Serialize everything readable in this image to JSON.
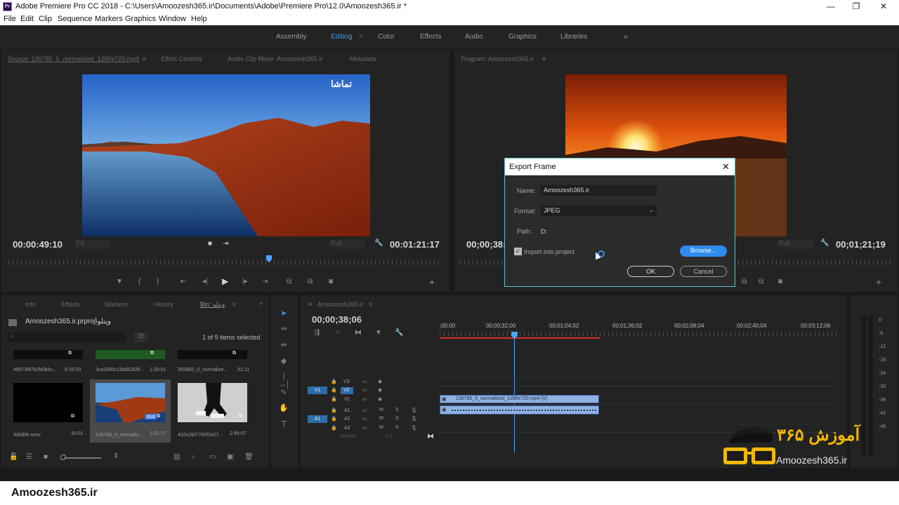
{
  "titlebar": {
    "app_icon": "Pr",
    "title": "Adobe Premiere Pro CC 2018 - C:\\Users\\Amoozesh365.ir\\Documents\\Adobe\\Premiere Pro\\12.0\\Amoozesh365.ir *",
    "minimize": "—",
    "maximize": "❐",
    "close": "✕"
  },
  "menu": [
    "File",
    "Edit",
    "Clip",
    "Sequence",
    "Markers",
    "Graphics",
    "Window",
    "Help"
  ],
  "workspaces": {
    "items": [
      "Assembly",
      "Editing",
      "Color",
      "Effects",
      "Audio",
      "Graphics",
      "Libraries"
    ],
    "active": "Editing",
    "more": "»"
  },
  "source_panel": {
    "tabs": [
      "Source: 136785_0_normalized_1280x720.mp4",
      "Effect Controls",
      "Audio Clip Mixer: Amoozesh365.ir",
      "Metadata"
    ],
    "timecode": "00:00:49:10",
    "fit": "Fit",
    "full": "Full",
    "duration": "00:01:21:17",
    "watermark": "تماشا"
  },
  "program_panel": {
    "tab": "Program: Amoozesh365.ir",
    "timecode": "00;00;38;06",
    "full": "Full",
    "duration": "00;01;21;19"
  },
  "export_dialog": {
    "title": "Export Frame",
    "name_label": "Name:",
    "name_value": "Amoozesh365.ir",
    "format_label": "Format:",
    "format_value": "JPEG",
    "path_label": "Path:",
    "path_value": "D:",
    "import_label": "Import into project",
    "import_checked": true,
    "browse": "Browse...",
    "ok": "OK",
    "cancel": "Cancel"
  },
  "project_panel": {
    "tabs": [
      "Info",
      "Effects",
      "Markers",
      "History",
      "Bin: ویتلو"
    ],
    "more": "»",
    "project_name": "Amoozesh365.ir.prproj\\ویتلو",
    "selection_info": "1 of 9 items selected",
    "items": [
      {
        "name": "48970f47b2b0b5c...",
        "duration": "6:33:00"
      },
      {
        "name": "3ce3395c15dd52b9f...",
        "duration": "1:33:01"
      },
      {
        "name": "355882_0_normalize...",
        "duration": "31:11"
      },
      {
        "name": "Wildlife.wmv",
        "duration": "30:01"
      },
      {
        "name": "136785_0_normaliz...",
        "duration": "1:21:17"
      },
      {
        "name": "432e2bf7765f0e27...",
        "duration": "2:45:07"
      }
    ]
  },
  "timeline": {
    "tab": "Amoozesh365.ir",
    "timecode": "00;00;38;06",
    "ruler_labels": [
      ";00;00",
      "00;00;32;00",
      "00;01;04;02",
      "00;01;36;02",
      "00;02;08;04",
      "00;02;40;04",
      "00;03;12;06"
    ],
    "tracks": [
      "V3",
      "V2",
      "V1",
      "A1",
      "A2",
      "A3"
    ],
    "src_video": "V1",
    "src_audio": "A1",
    "master": "Master",
    "master_value": "0.0",
    "clip_video": "136785_0_normalized_1280x720.mp4 [V]",
    "mute": "M",
    "solo": "S"
  },
  "audio_meter": {
    "labels": [
      "0",
      "-6",
      "-12",
      "-18",
      "-24",
      "-30",
      "-36",
      "-42",
      "-48"
    ]
  },
  "watermark_logo": {
    "persian": "آموزش ۳۶۵",
    "latin": "Amoozesh365.ir"
  },
  "bottom_caption": "Amoozesh365.ir",
  "colors": {
    "accent_blue": "#2d8ceb",
    "dialog_border": "#55c4c8",
    "playhead": "#4aa3ff",
    "work_area_red": "#e02a2a"
  }
}
